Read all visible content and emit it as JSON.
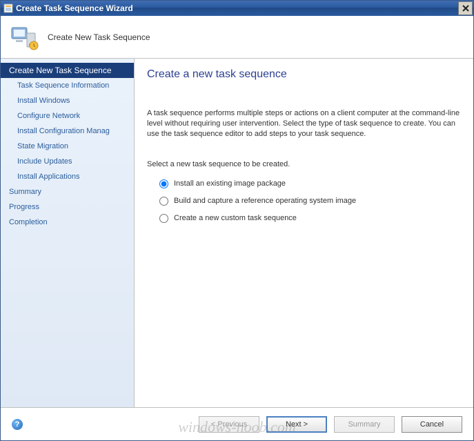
{
  "window": {
    "title": "Create Task Sequence Wizard"
  },
  "banner": {
    "subtitle": "Create New Task Sequence"
  },
  "sidebar": {
    "items": [
      {
        "label": "Create New Task Sequence",
        "selected": true,
        "sub": false
      },
      {
        "label": "Task Sequence Information",
        "sub": true
      },
      {
        "label": "Install Windows",
        "sub": true
      },
      {
        "label": "Configure Network",
        "sub": true
      },
      {
        "label": "Install Configuration Manag",
        "sub": true
      },
      {
        "label": "State Migration",
        "sub": true
      },
      {
        "label": "Include Updates",
        "sub": true
      },
      {
        "label": "Install Applications",
        "sub": true
      },
      {
        "label": "Summary",
        "sub": false
      },
      {
        "label": "Progress",
        "sub": false
      },
      {
        "label": "Completion",
        "sub": false
      }
    ]
  },
  "content": {
    "heading": "Create a new task sequence",
    "description": "A task sequence performs multiple steps or actions on a client computer at the command-line level without requiring user intervention. Select the type of task sequence to create. You can use the task sequence editor to add steps to your task sequence.",
    "prompt": "Select a new task sequence to be created.",
    "options": [
      {
        "label": "Install an existing image package",
        "checked": true
      },
      {
        "label": "Build and capture a reference operating system image",
        "checked": false
      },
      {
        "label": "Create a new custom task sequence",
        "checked": false
      }
    ]
  },
  "footer": {
    "previous": "< Previous",
    "next": "Next >",
    "summary": "Summary",
    "cancel": "Cancel"
  },
  "watermark": "windows-noob.com"
}
